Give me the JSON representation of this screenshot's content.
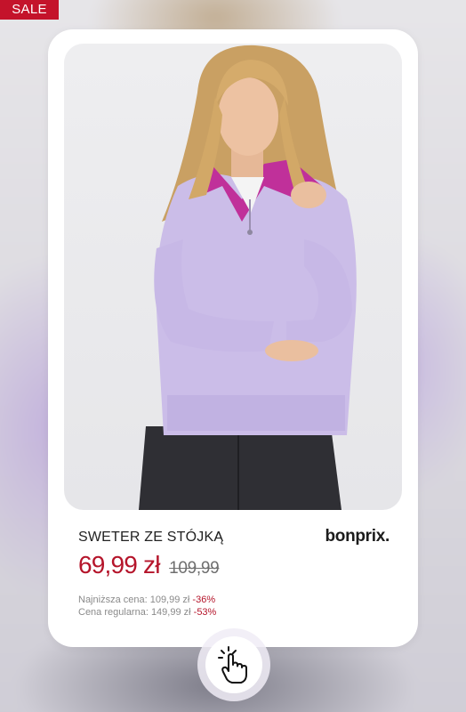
{
  "badge": {
    "label": "SALE"
  },
  "product": {
    "name": "SWETER ZE STÓJKĄ",
    "brand": "bonprix.",
    "price_current": "69,99 zł",
    "price_old": "109,99",
    "lowest_price_label": "Najniższa cena: 109,99 zł",
    "lowest_price_discount": "-36%",
    "regular_price_label": "Cena regularna: 149,99 zł",
    "regular_price_discount": "-53%",
    "image_icon": "model-photo"
  },
  "action": {
    "icon": "tap-hand-icon"
  },
  "colors": {
    "sale_red": "#c4132b",
    "price_red": "#b5152b",
    "card_bg": "#ffffff",
    "sweater_lilac": "#cbbde8"
  }
}
